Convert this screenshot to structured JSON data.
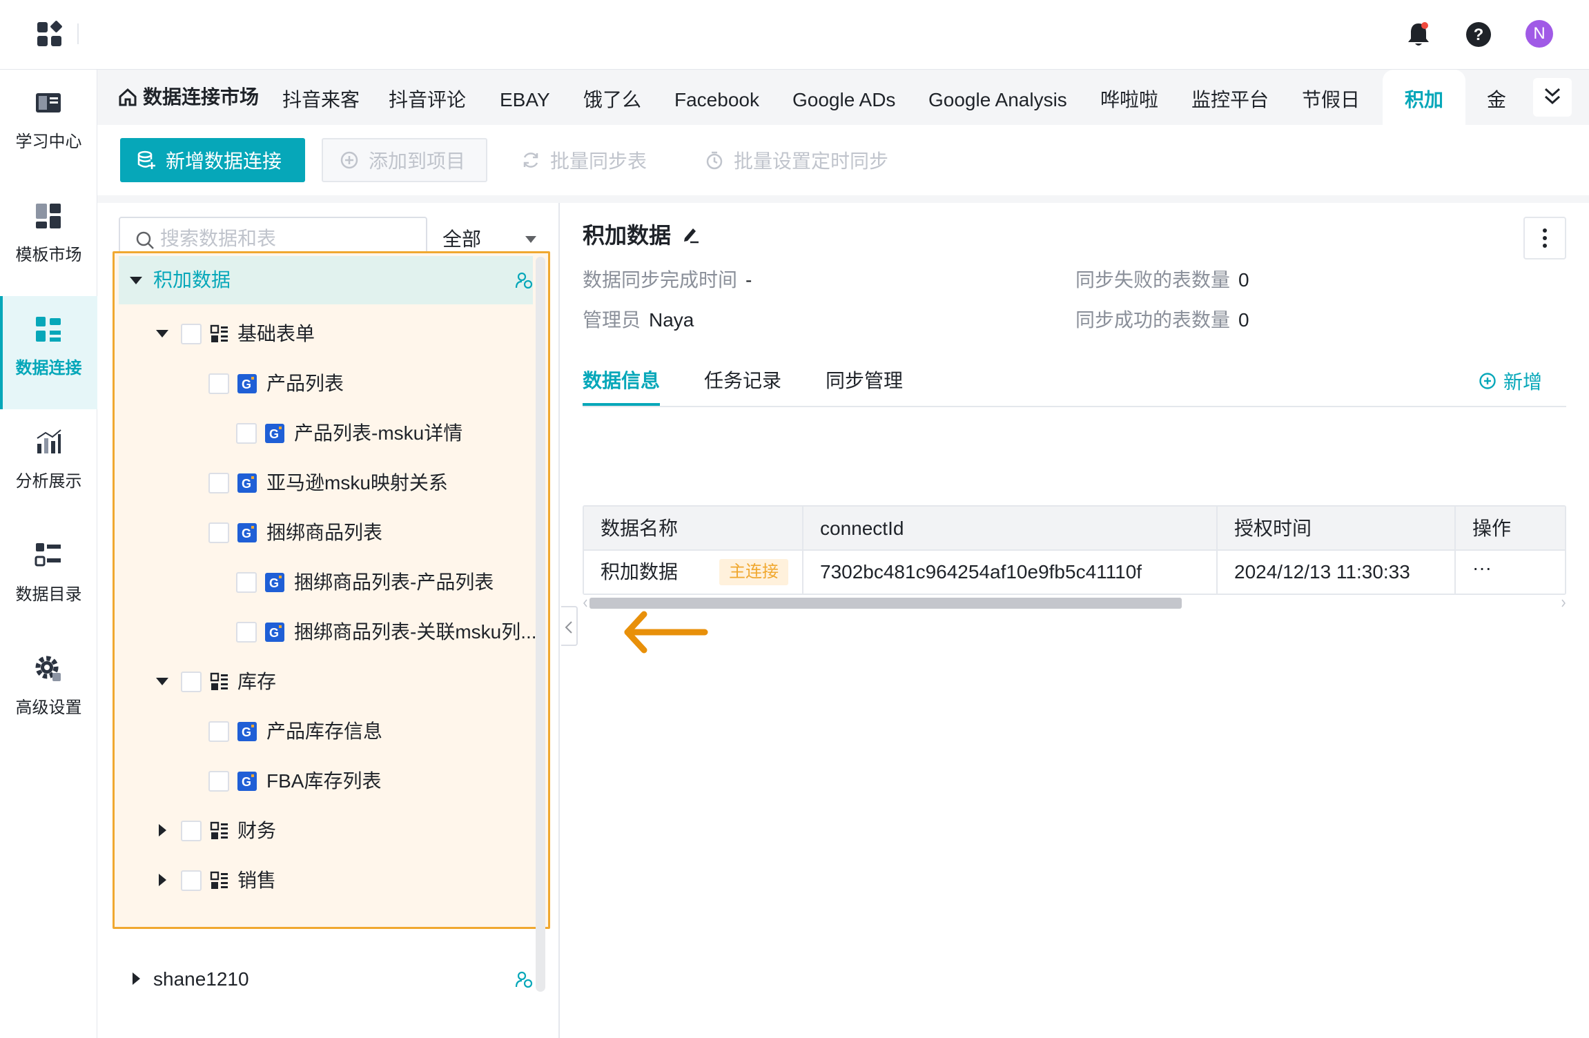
{
  "topbar": {
    "avatar_initial": "N"
  },
  "rail": {
    "items": [
      {
        "label": "学习中心",
        "icon": "book-icon"
      },
      {
        "label": "模板市场",
        "icon": "template-icon"
      },
      {
        "label": "数据连接",
        "icon": "data-connect-icon",
        "active": true
      },
      {
        "label": "分析展示",
        "icon": "chart-icon"
      },
      {
        "label": "数据目录",
        "icon": "catalog-icon"
      },
      {
        "label": "高级设置",
        "icon": "gear-icon"
      }
    ]
  },
  "tabs": {
    "home": "数据连接市场",
    "items": [
      "抖音来客",
      "抖音评论",
      "EBAY",
      "饿了么",
      "Facebook",
      "Google ADs",
      "Google Analysis",
      "哗啦啦",
      "监控平台",
      "节假日",
      "积加",
      "金"
    ],
    "active": "积加"
  },
  "toolbar": {
    "new_connection": "新增数据连接",
    "add_to_project": "添加到项目",
    "batch_sync": "批量同步表",
    "batch_schedule": "批量设置定时同步"
  },
  "tree": {
    "search_placeholder": "搜索数据和表",
    "filter_value": "全部",
    "root": "积加数据",
    "nodes": {
      "basic": "基础表单",
      "product_list": "产品列表",
      "product_msku": "产品列表-msku详情",
      "amazon_msku": "亚马逊msku映射关系",
      "bundle": "捆绑商品列表",
      "bundle_product": "捆绑商品列表-产品列表",
      "bundle_msku": "捆绑商品列表-关联msku列...",
      "stock": "库存",
      "stock_info": "产品库存信息",
      "fba_stock": "FBA库存列表",
      "finance": "财务",
      "sales": "销售"
    },
    "other_root": "shane1210"
  },
  "detail": {
    "title": "积加数据",
    "sync_time_label": "数据同步完成时间",
    "sync_time_value": "-",
    "failed_label": "同步失败的表数量",
    "failed_value": "0",
    "admin_label": "管理员",
    "admin_value": "Naya",
    "success_label": "同步成功的表数量",
    "success_value": "0",
    "tabs": [
      "数据信息",
      "任务记录",
      "同步管理"
    ],
    "add_label": "新增",
    "table": {
      "headers": [
        "数据名称",
        "connectId",
        "授权时间",
        "操作"
      ],
      "row": {
        "name": "积加数据",
        "badge": "主连接",
        "connect_id": "7302bc481c964254af10e9fb5c41110f",
        "auth_time": "2024/12/13 11:30:33",
        "ops": "···"
      }
    }
  },
  "colors": {
    "accent": "#06a7b9",
    "highlight_border": "#f0a830",
    "annotation_arrow": "#e8900a"
  }
}
